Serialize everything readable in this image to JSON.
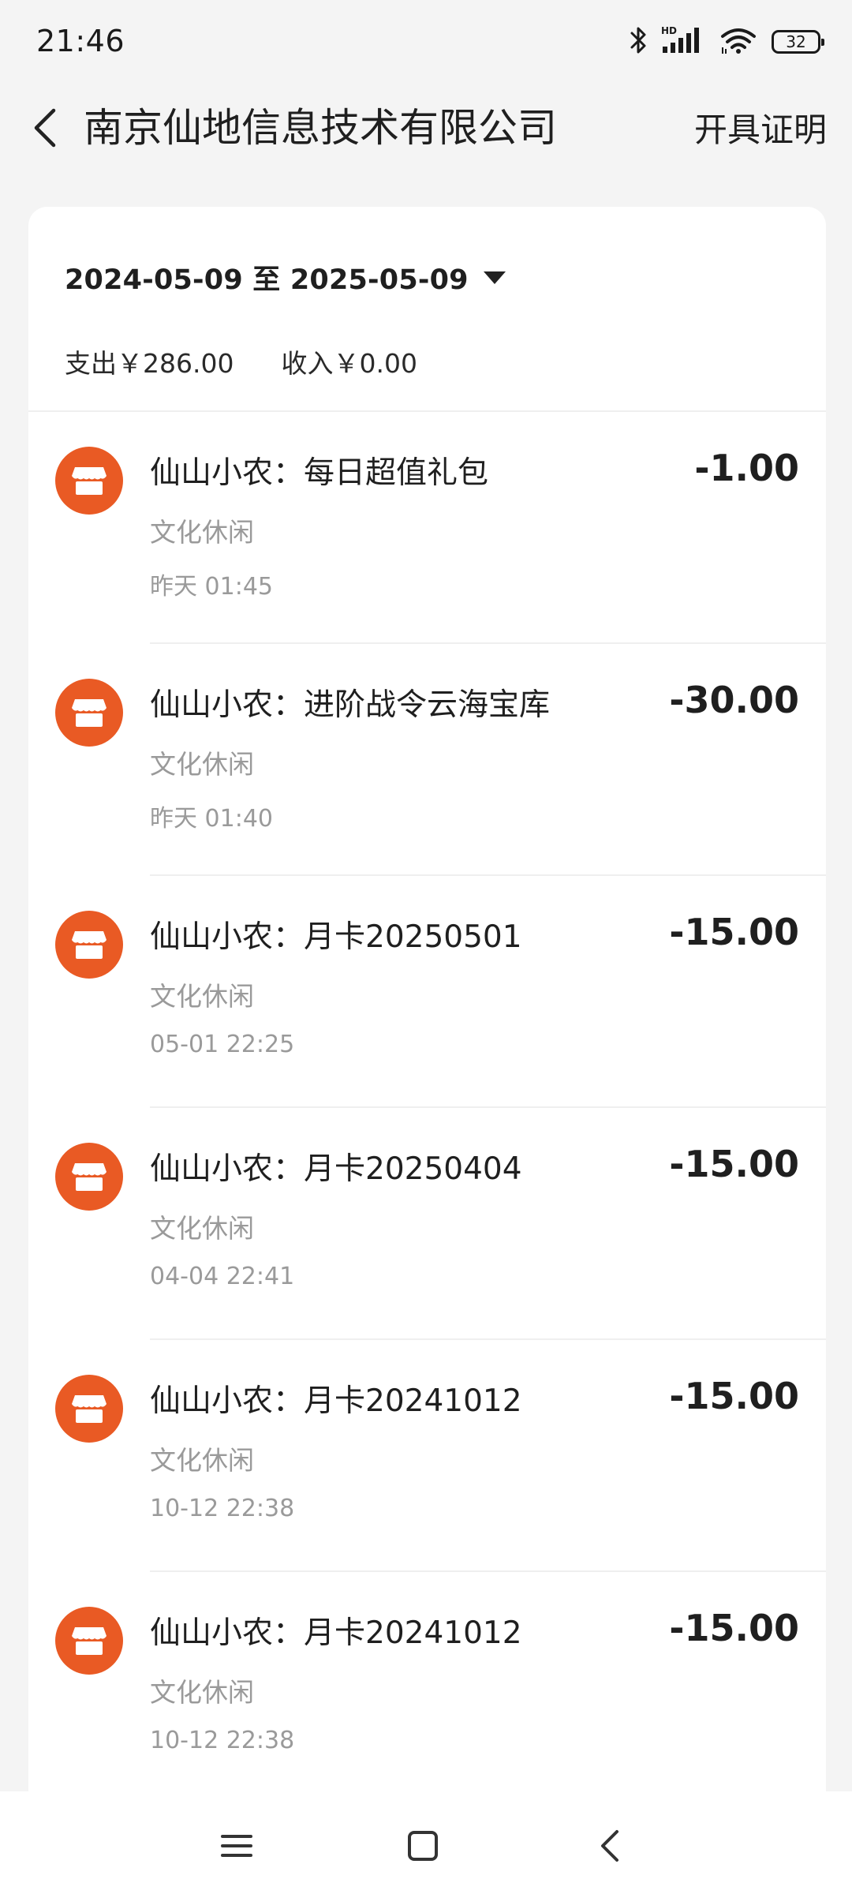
{
  "status_bar": {
    "time": "21:46",
    "battery": "32",
    "icons": [
      "bluetooth-icon",
      "hd-signal-icon",
      "wifi-icon",
      "battery-icon"
    ]
  },
  "header": {
    "back_icon": "chevron-left-icon",
    "title": "南京仙地信息技术有限公司",
    "action": "开具证明"
  },
  "filter": {
    "date_range": "2024-05-09 至 2025-05-09",
    "dropdown_icon": "caret-down-icon"
  },
  "summary": {
    "expense": "支出￥286.00",
    "income": "收入￥0.00"
  },
  "transactions": [
    {
      "title": "仙山小农：每日超值礼包",
      "category": "文化休闲",
      "time": "昨天 01:45",
      "amount": "-1.00"
    },
    {
      "title": "仙山小农：进阶战令云海宝库",
      "category": "文化休闲",
      "time": "昨天 01:40",
      "amount": "-30.00"
    },
    {
      "title": "仙山小农：月卡20250501",
      "category": "文化休闲",
      "time": "05-01 22:25",
      "amount": "-15.00"
    },
    {
      "title": "仙山小农：月卡20250404",
      "category": "文化休闲",
      "time": "04-04 22:41",
      "amount": "-15.00"
    },
    {
      "title": "仙山小农：月卡20241012",
      "category": "文化休闲",
      "time": "10-12 22:38",
      "amount": "-15.00"
    },
    {
      "title": "仙山小农：月卡20241012",
      "category": "文化休闲",
      "time": "10-12 22:38",
      "amount": "-15.00"
    }
  ],
  "nav_bar": {
    "icons": [
      "menu-icon",
      "home-square-icon",
      "back-icon"
    ]
  },
  "colors": {
    "accent": "#e95a24",
    "background": "#f4f4f4",
    "card": "#ffffff",
    "muted_text": "#9a9a9a"
  }
}
